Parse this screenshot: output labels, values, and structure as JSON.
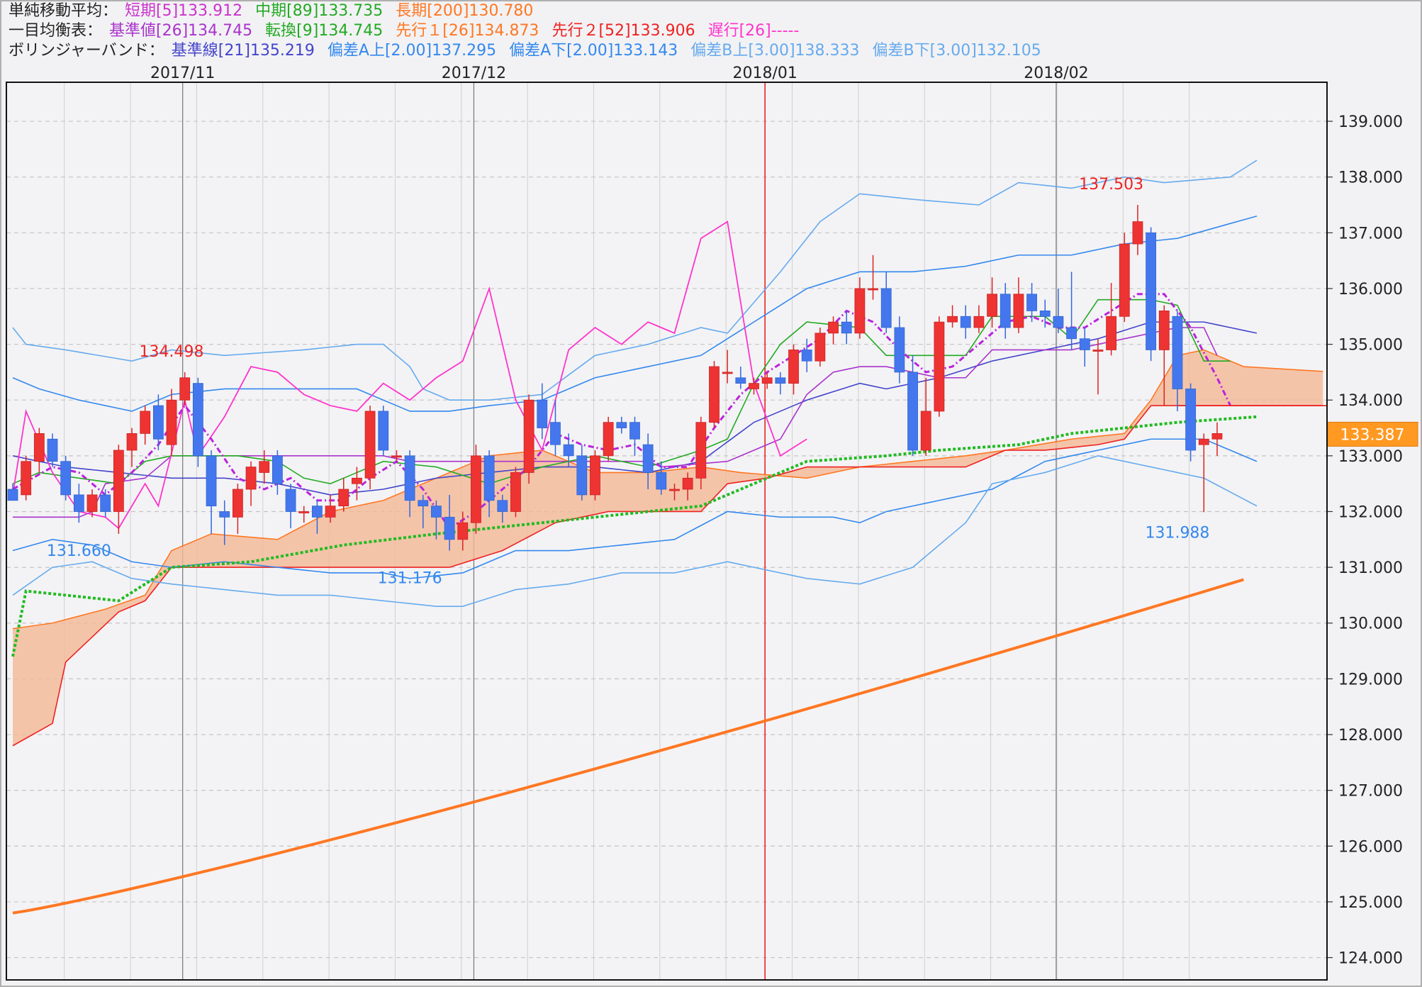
{
  "legend": {
    "sma": {
      "title": "単純移動平均：",
      "short": "短期[5]133.912",
      "mid": "中期[89]133.735",
      "long": "長期[200]130.780",
      "colors": {
        "short": "#cc33cc",
        "mid": "#22aa22",
        "long": "#ff7722"
      }
    },
    "ichimoku": {
      "title": "一目均衡表：",
      "kijun": "基準値[26]134.745",
      "tenkan": "転換[9]134.745",
      "span1": "先行１[26]134.873",
      "span2": "先行２[52]133.906",
      "chikou": "遅行[26]-----",
      "colors": {
        "kijun": "#aa33cc",
        "tenkan": "#22aa22",
        "span1": "#ff7722",
        "span2": "#ee2222",
        "chikou": "#ff33cc"
      }
    },
    "bollinger": {
      "title": "ボリンジャーバンド：",
      "base": "基準線[21]135.219",
      "upA": "偏差A上[2.00]137.295",
      "dnA": "偏差A下[2.00]133.143",
      "upB": "偏差B上[3.00]138.333",
      "dnB": "偏差B下[3.00]132.105",
      "colors": {
        "base": "#4444cc",
        "a": "#3388ee",
        "b": "#66aaee"
      }
    }
  },
  "chart_data": {
    "type": "candlestick",
    "ylim": [
      123.6,
      139.7
    ],
    "y_ticks": [
      "124.000",
      "125.000",
      "126.000",
      "127.000",
      "128.000",
      "129.000",
      "130.000",
      "131.000",
      "132.000",
      "133.000",
      "134.000",
      "135.000",
      "136.000",
      "137.000",
      "138.000",
      "139.000"
    ],
    "month_labels": [
      {
        "label": "2017/11",
        "i": 13
      },
      {
        "label": "2017/12",
        "i": 35
      },
      {
        "label": "2018/01",
        "i": 57
      },
      {
        "label": "2018/02",
        "i": 79
      }
    ],
    "current_price": "133.387",
    "current_value": 133.387,
    "annotations": [
      {
        "text": "134.498",
        "i": 12,
        "value": 134.498,
        "color": "#ee2222",
        "pos": "above"
      },
      {
        "text": "131.660",
        "i": 5,
        "value": 131.66,
        "color": "#3388ee",
        "pos": "below"
      },
      {
        "text": "131.176",
        "i": 30,
        "value": 131.176,
        "color": "#3388ee",
        "pos": "below"
      },
      {
        "text": "137.503",
        "i": 83,
        "value": 137.503,
        "color": "#ee2222",
        "pos": "above"
      },
      {
        "text": "131.988",
        "i": 88,
        "value": 131.988,
        "color": "#3388ee",
        "pos": "below"
      }
    ],
    "candles": [
      [
        132.4,
        132.2,
        132.3,
        132.5
      ],
      [
        132.3,
        132.9,
        132.2,
        133.0
      ],
      [
        132.9,
        133.4,
        132.7,
        133.5
      ],
      [
        133.3,
        132.9,
        132.8,
        133.4
      ],
      [
        132.9,
        132.3,
        132.2,
        133.0
      ],
      [
        132.3,
        132.0,
        131.8,
        132.5
      ],
      [
        132.0,
        132.3,
        131.9,
        132.4
      ],
      [
        132.3,
        132.0,
        131.9,
        132.4
      ],
      [
        132.0,
        133.1,
        131.6,
        133.2
      ],
      [
        133.1,
        133.4,
        132.8,
        133.5
      ],
      [
        133.4,
        133.8,
        133.2,
        133.9
      ],
      [
        133.9,
        133.3,
        133.1,
        134.1
      ],
      [
        133.2,
        134.0,
        133.0,
        134.2
      ],
      [
        134.0,
        134.4,
        133.9,
        134.5
      ],
      [
        134.3,
        133.0,
        132.8,
        134.4
      ],
      [
        133.0,
        132.1,
        131.6,
        133.1
      ],
      [
        132.0,
        131.9,
        131.4,
        132.2
      ],
      [
        131.9,
        132.4,
        131.6,
        132.5
      ],
      [
        132.4,
        132.8,
        132.1,
        132.9
      ],
      [
        132.7,
        132.9,
        132.5,
        133.1
      ],
      [
        133.0,
        132.5,
        132.3,
        133.1
      ],
      [
        132.4,
        132.0,
        131.7,
        132.5
      ],
      [
        132.0,
        132.0,
        131.8,
        132.1
      ],
      [
        132.1,
        131.9,
        131.6,
        132.2
      ],
      [
        131.9,
        132.1,
        131.8,
        132.3
      ],
      [
        132.1,
        132.4,
        132.0,
        132.6
      ],
      [
        132.5,
        132.6,
        132.2,
        132.8
      ],
      [
        132.6,
        133.8,
        132.4,
        133.9
      ],
      [
        133.8,
        133.1,
        133.0,
        133.9
      ],
      [
        133.0,
        133.0,
        132.9,
        133.1
      ],
      [
        133.0,
        132.2,
        131.9,
        133.1
      ],
      [
        132.2,
        132.1,
        131.7,
        132.3
      ],
      [
        132.1,
        131.9,
        131.5,
        132.2
      ],
      [
        131.9,
        131.5,
        131.3,
        132.3
      ],
      [
        131.5,
        131.8,
        131.3,
        132.0
      ],
      [
        131.8,
        133.0,
        131.6,
        133.2
      ],
      [
        133.0,
        132.2,
        131.9,
        133.1
      ],
      [
        132.2,
        132.0,
        131.8,
        132.3
      ],
      [
        132.0,
        132.7,
        131.9,
        132.8
      ],
      [
        132.7,
        134.0,
        132.5,
        134.1
      ],
      [
        134.0,
        133.5,
        133.3,
        134.3
      ],
      [
        133.6,
        133.2,
        133.0,
        134.0
      ],
      [
        133.2,
        133.0,
        132.8,
        133.4
      ],
      [
        133.0,
        132.3,
        132.2,
        133.2
      ],
      [
        132.3,
        133.0,
        132.2,
        133.1
      ],
      [
        133.0,
        133.6,
        132.9,
        133.7
      ],
      [
        133.6,
        133.5,
        133.4,
        133.7
      ],
      [
        133.6,
        133.3,
        133.0,
        133.7
      ],
      [
        133.2,
        132.7,
        132.4,
        133.4
      ],
      [
        132.7,
        132.4,
        132.3,
        132.9
      ],
      [
        132.4,
        132.4,
        132.2,
        132.5
      ],
      [
        132.4,
        132.6,
        132.2,
        132.7
      ],
      [
        132.6,
        133.6,
        132.4,
        133.7
      ],
      [
        133.6,
        134.6,
        133.5,
        134.7
      ],
      [
        134.5,
        134.5,
        134.3,
        134.9
      ],
      [
        134.4,
        134.3,
        134.2,
        134.6
      ],
      [
        134.2,
        134.3,
        134.1,
        134.4
      ],
      [
        134.3,
        134.4,
        134.2,
        134.5
      ],
      [
        134.4,
        134.3,
        134.1,
        134.5
      ],
      [
        134.3,
        134.9,
        134.1,
        135.0
      ],
      [
        134.9,
        134.7,
        134.5,
        135.1
      ],
      [
        134.7,
        135.2,
        134.6,
        135.3
      ],
      [
        135.2,
        135.4,
        135.0,
        135.5
      ],
      [
        135.4,
        135.2,
        135.0,
        135.6
      ],
      [
        135.2,
        136.0,
        135.1,
        136.2
      ],
      [
        136.0,
        136.0,
        135.8,
        136.6
      ],
      [
        136.0,
        135.3,
        135.2,
        136.3
      ],
      [
        135.3,
        134.5,
        134.3,
        135.5
      ],
      [
        134.5,
        133.1,
        133.0,
        134.8
      ],
      [
        133.1,
        133.8,
        133.0,
        134.4
      ],
      [
        133.8,
        135.4,
        133.7,
        135.5
      ],
      [
        135.4,
        135.5,
        135.3,
        135.7
      ],
      [
        135.5,
        135.3,
        135.1,
        135.7
      ],
      [
        135.3,
        135.5,
        135.2,
        135.7
      ],
      [
        135.5,
        135.9,
        135.3,
        136.2
      ],
      [
        135.9,
        135.3,
        135.1,
        136.1
      ],
      [
        135.3,
        135.9,
        135.2,
        136.2
      ],
      [
        135.9,
        135.6,
        135.4,
        136.1
      ],
      [
        135.6,
        135.5,
        135.3,
        135.8
      ],
      [
        135.5,
        135.3,
        135.2,
        136.0
      ],
      [
        135.3,
        135.1,
        134.9,
        136.3
      ],
      [
        135.1,
        134.9,
        134.6,
        135.3
      ],
      [
        134.9,
        134.9,
        134.1,
        135.1
      ],
      [
        134.9,
        135.5,
        134.8,
        136.1
      ],
      [
        135.5,
        136.8,
        135.4,
        137.0
      ],
      [
        136.8,
        137.2,
        136.6,
        137.5
      ],
      [
        137.0,
        134.9,
        134.7,
        137.1
      ],
      [
        134.9,
        135.6,
        133.9,
        135.7
      ],
      [
        135.5,
        134.2,
        133.8,
        135.6
      ],
      [
        134.2,
        133.1,
        132.9,
        134.3
      ],
      [
        133.2,
        133.3,
        131.99,
        133.4
      ],
      [
        133.3,
        133.4,
        133.0,
        133.6
      ]
    ]
  }
}
